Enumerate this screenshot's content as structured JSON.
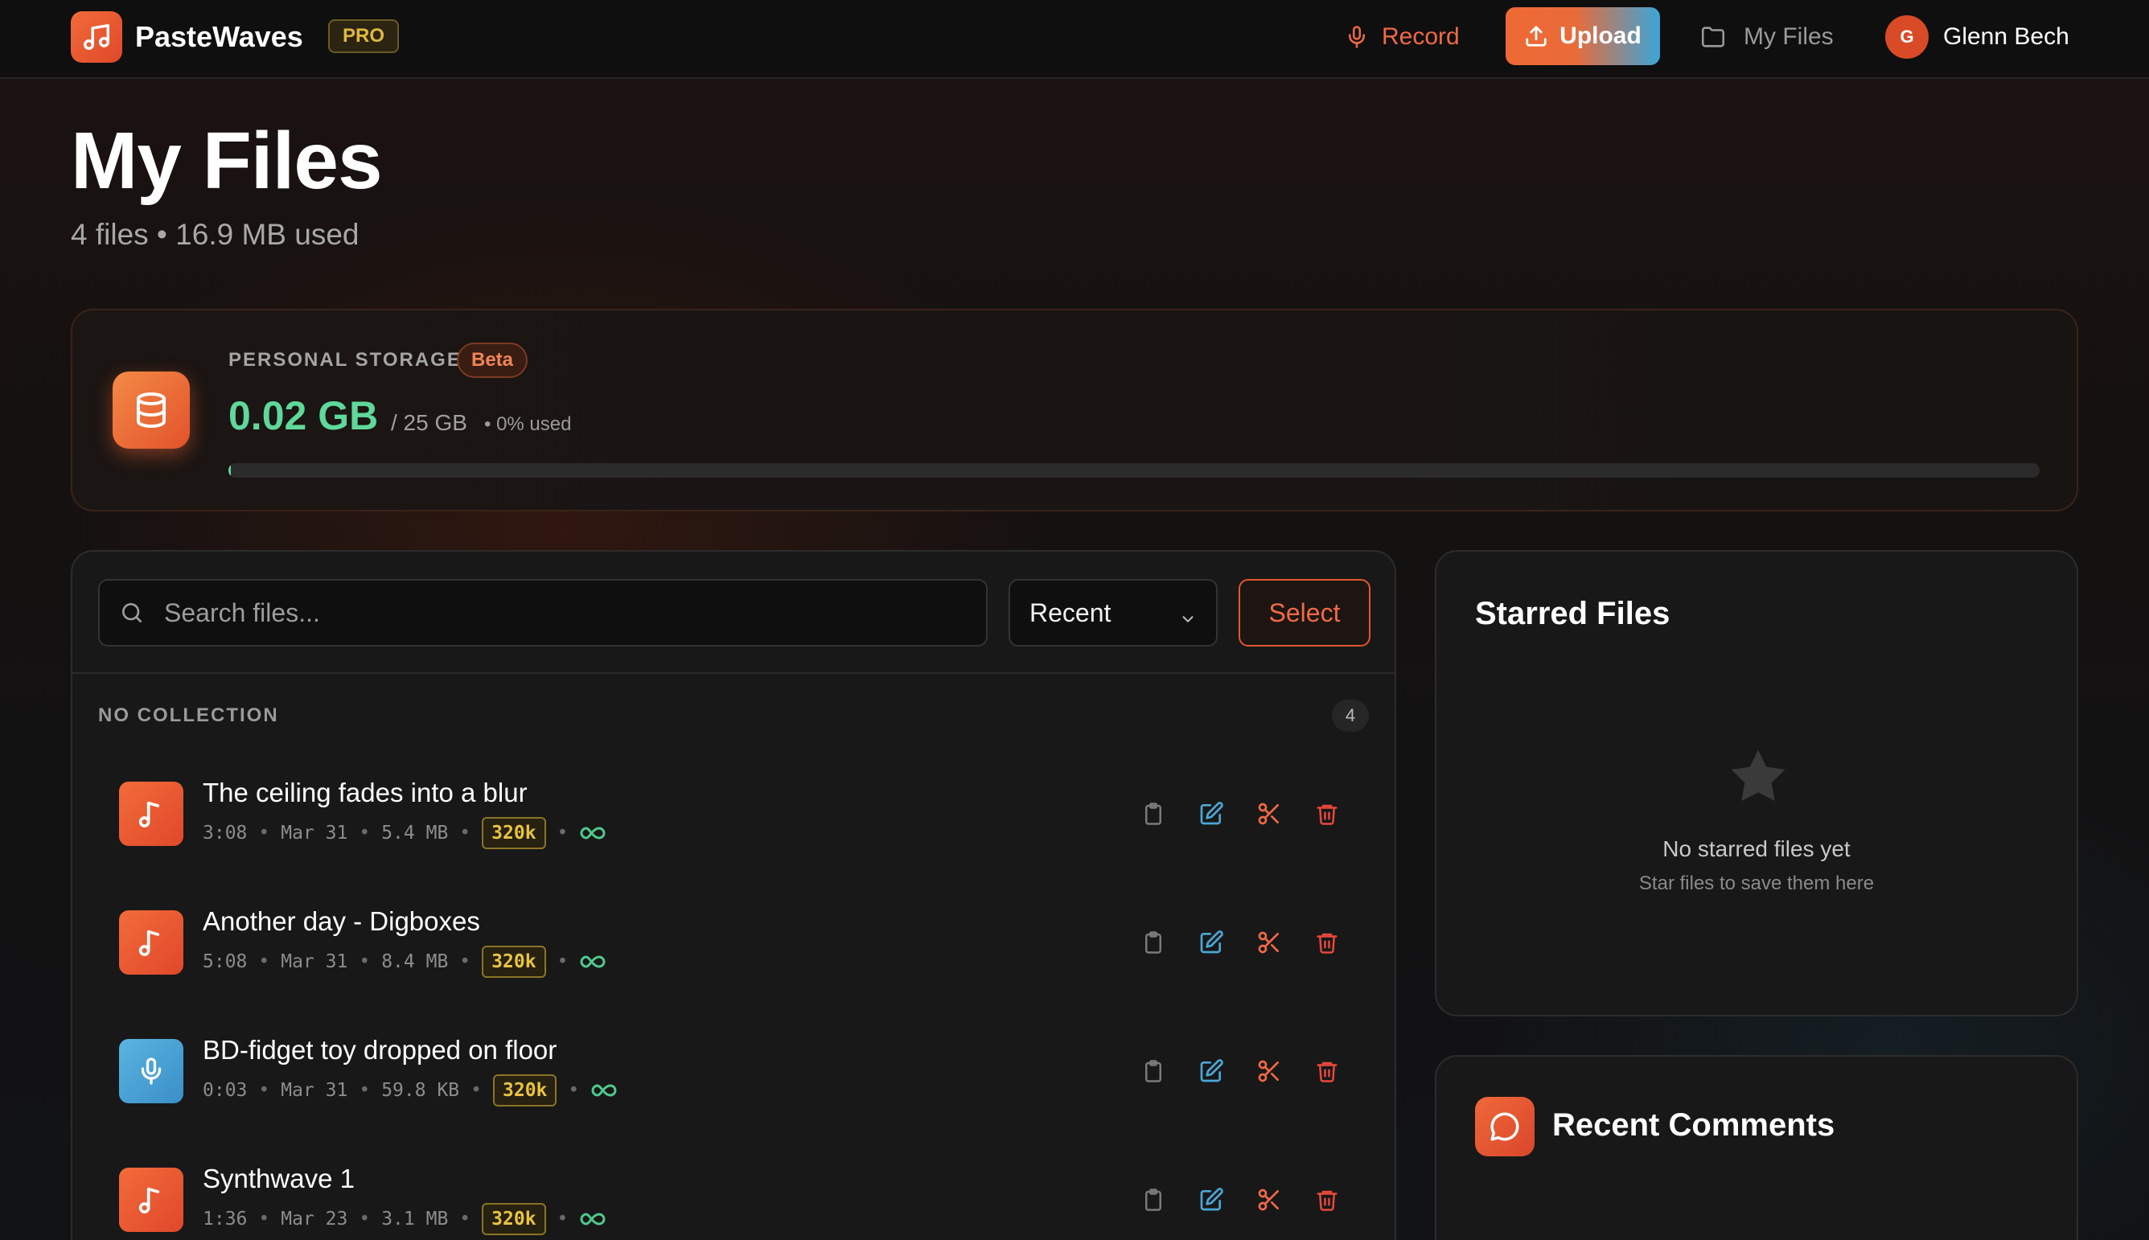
{
  "colors": {
    "accent": "#f06a45",
    "green": "#5fd89a",
    "gold": "#e9c440",
    "blue": "#4aa8d8",
    "background": "#121212"
  },
  "nav": {
    "brand": "PasteWaves",
    "badge": "PRO",
    "record_label": "Record",
    "upload_label": "Upload",
    "myfiles_label": "My Files",
    "user_initial": "G",
    "user_name": "Glenn Bech"
  },
  "header": {
    "title": "My Files",
    "subtitle": "4 files • 16.9 MB used"
  },
  "storage": {
    "label": "PERSONAL STORAGE",
    "badge": "Beta",
    "used": "0.02 GB",
    "total": "/ 25 GB",
    "percent_text": "• 0% used",
    "fill_fraction": 0.001
  },
  "files_panel": {
    "search_placeholder": "Search files...",
    "sort_value": "Recent",
    "select_label": "Select",
    "collection_label": "NO COLLECTION",
    "collection_count": "4",
    "files": [
      {
        "title": "The ceiling fades into a blur",
        "duration": "3:08",
        "date": "Mar 31",
        "size": "5.4 MB",
        "bitrate": "320k",
        "type": "music"
      },
      {
        "title": "Another day - Digboxes",
        "duration": "5:08",
        "date": "Mar 31",
        "size": "8.4 MB",
        "bitrate": "320k",
        "type": "music"
      },
      {
        "title": "BD-fidget toy dropped on floor",
        "duration": "0:03",
        "date": "Mar 31",
        "size": "59.8 KB",
        "bitrate": "320k",
        "type": "recording"
      },
      {
        "title": "Synthwave 1",
        "duration": "1:36",
        "date": "Mar 23",
        "size": "3.1 MB",
        "bitrate": "320k",
        "type": "music"
      }
    ]
  },
  "starred": {
    "title": "Starred Files",
    "empty_text": "No starred files yet",
    "hint_text": "Star files to save them here"
  },
  "comments": {
    "title": "Recent Comments"
  }
}
